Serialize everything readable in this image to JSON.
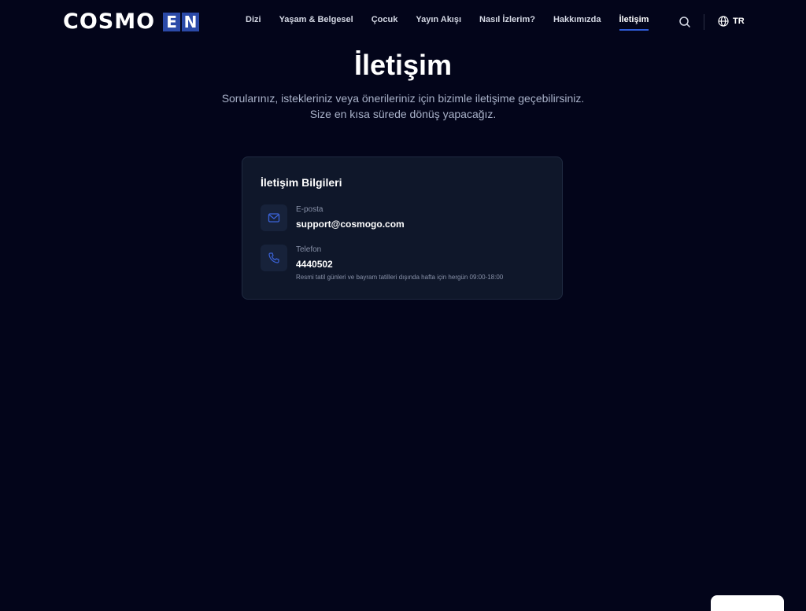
{
  "header": {
    "logo_text": "COSMO",
    "logo_suffix_1": "E",
    "logo_suffix_2": "N",
    "nav": [
      {
        "label": "Dizi"
      },
      {
        "label": "Yaşam & Belgesel"
      },
      {
        "label": "Çocuk"
      },
      {
        "label": "Yayın Akışı"
      },
      {
        "label": "Nasıl İzlerim?"
      },
      {
        "label": "Hakkımızda"
      },
      {
        "label": "İletişim"
      }
    ],
    "active_nav": "İletişim",
    "language": "TR",
    "icons": {
      "search": "search-icon",
      "language": "globe-icon"
    }
  },
  "main": {
    "title": "İletişim",
    "subtitle_line1": "Sorularınız, istekleriniz veya önerileriniz için bizimle iletişime geçebilirsiniz.",
    "subtitle_line2": "Size en kısa sürede dönüş yapacağız."
  },
  "contact_card": {
    "title": "İletişim Bilgileri",
    "email": {
      "icon": "mail-icon",
      "label": "E-posta",
      "value": "support@cosmogo.com"
    },
    "phone": {
      "icon": "phone-icon",
      "label": "Telefon",
      "value": "4440502",
      "note": "Resmi tatil günleri ve bayram tatilleri dışında hafta için hergün 09:00-18:00"
    }
  },
  "colors": {
    "background": "#03051a",
    "card": "#0f172a",
    "accent": "#2f5bd6",
    "logo_box": "#2b4aa8",
    "muted_text": "#a9b2c9"
  }
}
